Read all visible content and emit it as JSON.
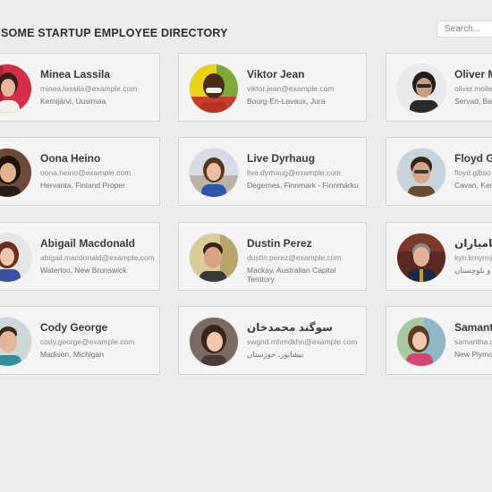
{
  "header": {
    "title": "SOME STARTUP EMPLOYEE DIRECTORY",
    "search_placeholder": "Search..."
  },
  "employees": [
    {
      "name": "Minea Lassila",
      "email": "minea.lassila@example.com",
      "location": "Kemijärvi, Uusimaa"
    },
    {
      "name": "Viktor Jean",
      "email": "viktor.jean@example.com",
      "location": "Bourg-En-Lavaux, Jura"
    },
    {
      "name": "Oliver M",
      "email": "oliver.molle",
      "location": "Servad, Bas"
    },
    {
      "name": "Oona Heino",
      "email": "oona.heino@example.com",
      "location": "Hervanta, Finland Proper"
    },
    {
      "name": "Live Dyrhaug",
      "email": "live.dyrhaug@example.com",
      "location": "Degernes, Finnmark - Finnmárku"
    },
    {
      "name": "Floyd Gi",
      "email": "floyd.gibso",
      "location": "Cavan, Ker"
    },
    {
      "name": "Abigail Macdonald",
      "email": "abigail.macdonald@example.com",
      "location": "Waterloo, New Brunswick"
    },
    {
      "name": "Dustin Perez",
      "email": "dustin.perez@example.com",
      "location": "Mackay, Australian Capital Territory"
    },
    {
      "name": "ن کامیاران",
      "email": "kyn.kmyrn@",
      "location": "ان و بلوچستان"
    },
    {
      "name": "Cody George",
      "email": "cody.george@example.com",
      "location": "Madison, Michigan"
    },
    {
      "name": "سوگند محمدخان",
      "email": "swgnd.mhmdkhn@example.com",
      "location": "نیشابور، خوزستان"
    },
    {
      "name": "Samanth",
      "email": "samantha.g",
      "location": "New Plymo"
    }
  ]
}
